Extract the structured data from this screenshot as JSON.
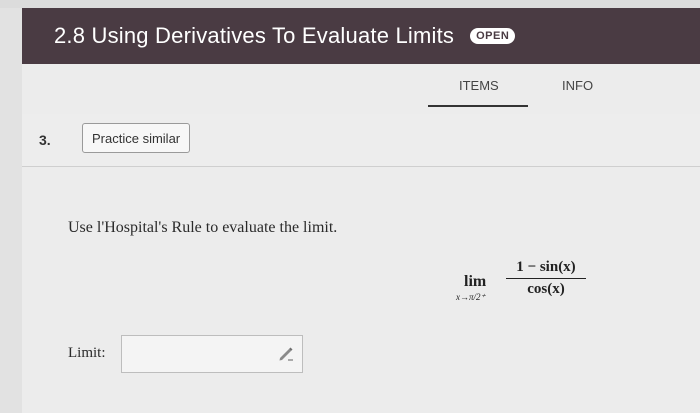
{
  "header": {
    "title": "2.8 Using Derivatives To Evaluate Limits",
    "badge": "OPEN"
  },
  "tabs": [
    {
      "label": "ITEMS",
      "active": true
    },
    {
      "label": "INFO",
      "active": false
    }
  ],
  "question": {
    "number": "3.",
    "practice_label": "Practice similar",
    "prompt": "Use l'Hospital's Rule to evaluate the limit.",
    "math": {
      "lim": "lim",
      "subscript": "x→π/2⁺",
      "numerator": "1 − sin(x)",
      "denominator": "cos(x)"
    },
    "answer_label": "Limit:",
    "answer_value": ""
  },
  "colors": {
    "header_bg": "#4a3b43",
    "page_bg": "#ececec"
  },
  "icons": {
    "answer_tool": "pencil-icon"
  }
}
